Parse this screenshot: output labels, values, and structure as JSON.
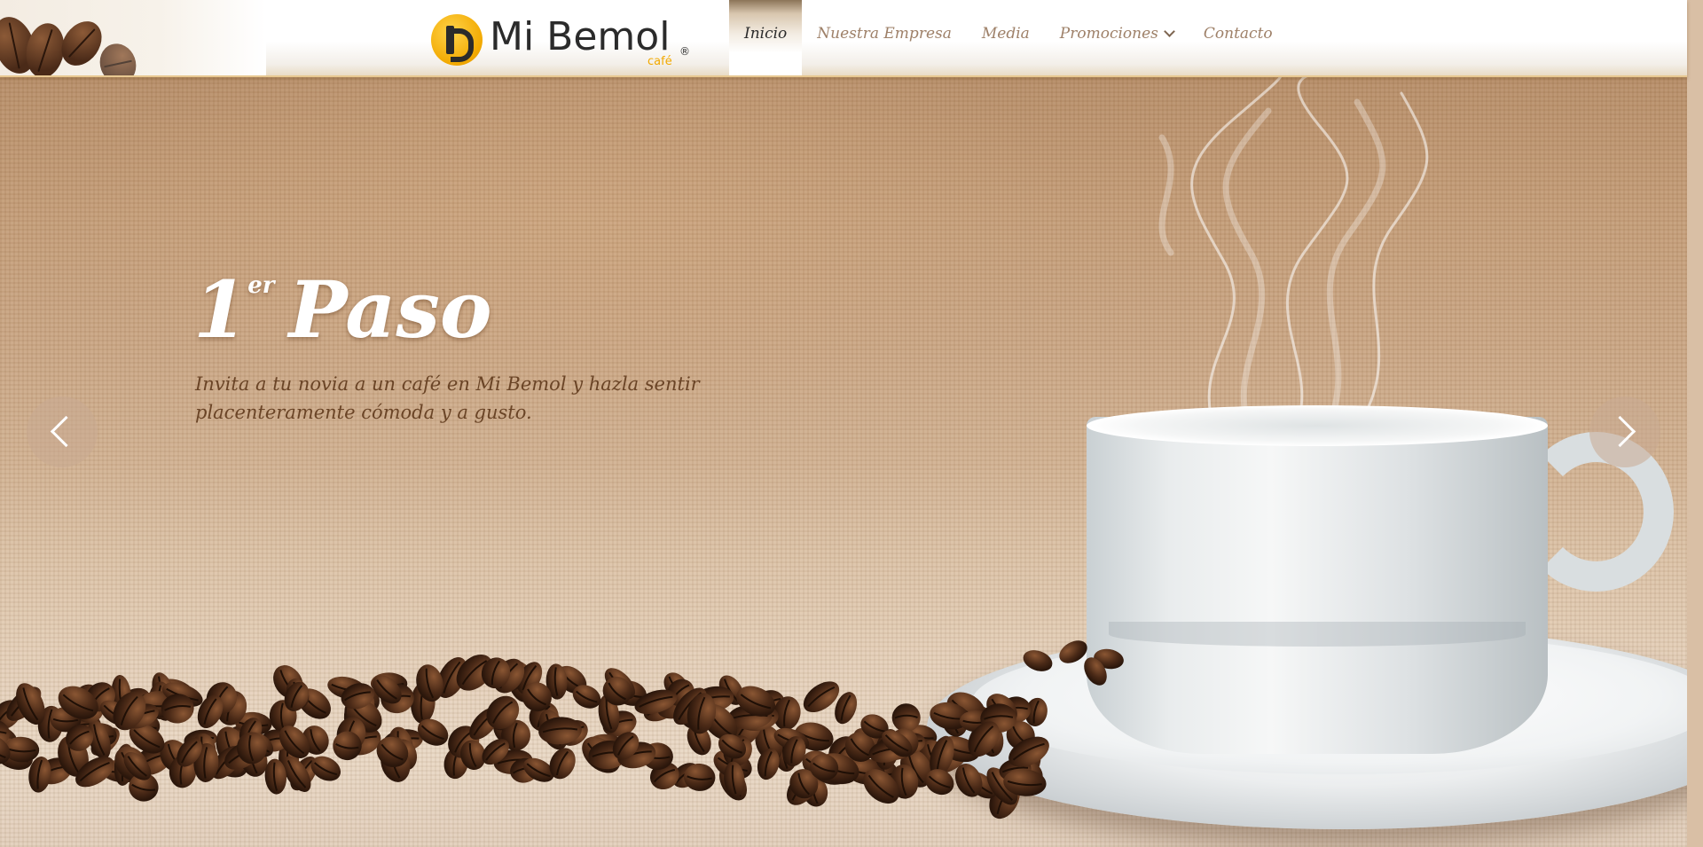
{
  "brand": {
    "name": "Mi Bemol",
    "registered": "®",
    "subtitle": "café"
  },
  "nav": {
    "items": [
      {
        "label": "Inicio",
        "active": true
      },
      {
        "label": "Nuestra Empresa",
        "active": false
      },
      {
        "label": "Media",
        "active": false
      },
      {
        "label": "Promociones",
        "active": false,
        "has_dropdown": true
      },
      {
        "label": "Contacto",
        "active": false
      }
    ]
  },
  "slide": {
    "title_number": "1",
    "title_superscript": "er",
    "title_word": "Paso",
    "text": "Invita a tu novia a un café en Mi Bemol y hazla sentir placenteramente cómoda y a gusto."
  },
  "carousel": {
    "prev_icon": "chevron-left-icon",
    "next_icon": "chevron-right-icon"
  },
  "colors": {
    "accent": "#f2a900",
    "nav_text": "#9e8068",
    "slide_text": "#6a4426"
  }
}
